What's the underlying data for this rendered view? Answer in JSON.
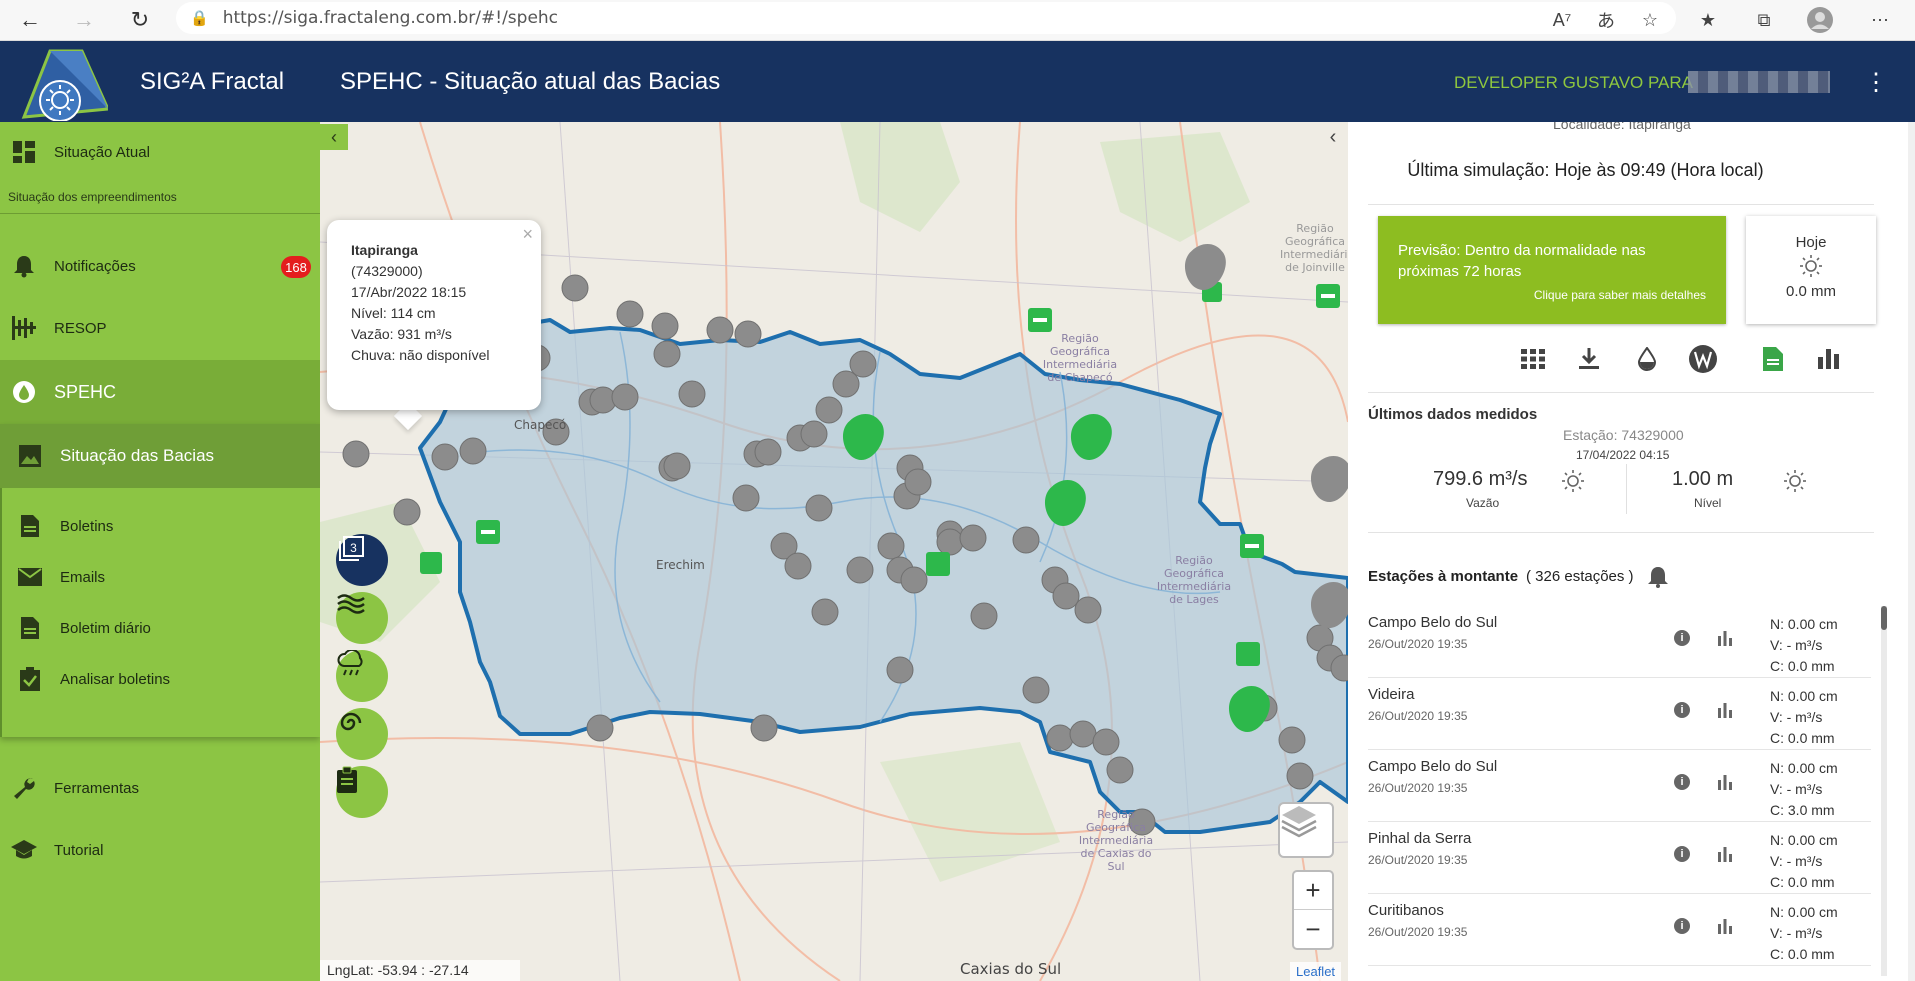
{
  "browser": {
    "url": "https://siga.fractaleng.com.br/#!/spehc"
  },
  "header": {
    "app_name": "SIG²A Fractal",
    "page_title": "SPEHC - Situação atual das Bacias",
    "user_label": "DEVELOPER GUSTAVO PARA"
  },
  "sidebar": {
    "situacao_atual": "Situação Atual",
    "subtitle": "Situação dos empreendimentos",
    "notificacoes": "Notificações",
    "notif_count": "168",
    "resop": "RESOP",
    "spehc": "SPEHC",
    "sub": {
      "situacao_bacias": "Situação das Bacias",
      "boletins": "Boletins",
      "emails": "Emails",
      "boletim_diario": "Boletim diário",
      "analisar_boletins": "Analisar boletins"
    },
    "ferramentas": "Ferramentas",
    "tutorial": "Tutorial"
  },
  "map": {
    "popup": {
      "title": "Itapiranga",
      "code": "(74329000)",
      "datetime": "17/Abr/2022 18:15",
      "nivel": "Nível: 114 cm",
      "vazao": "Vazão: 931 m³/s",
      "chuva": "Chuva: não disponível",
      "close": "×"
    },
    "labels": {
      "chapeco": "Chapecó",
      "erechim": "Erechim",
      "caxias": "Caxias do Sul",
      "regiao_joinville": "Região Geográfica Intermediária de Joinville",
      "regiao_lages": "Região Geográfica Intermediária de Lages",
      "regiao_chapeco": "Região Geográfica Intermediária de Chapecó",
      "regiao_caxias": "Região Geográfica Intermediária de Caxias do Sul"
    },
    "lnglat": "LngLat: -53.94 : -27.14",
    "attribution": "Leaflet",
    "zoom_in": "+",
    "zoom_out": "−",
    "colors": {
      "basin_fill": "#a9c6d9",
      "basin_stroke": "#1e6fae",
      "marker_grey": "#8c8c8c",
      "marker_green": "#2db84b"
    }
  },
  "panel": {
    "localidade": "Localidade: Itapiranga",
    "last_sim": "Última simulação: Hoje às 09:49 (Hora local)",
    "forecast_text": "Previsão: Dentro da normalidade nas próximas 72 horas",
    "forecast_link": "Clique para saber mais detalhes",
    "today_label": "Hoje",
    "today_rain": "0.0 mm",
    "ultimos_title": "Últimos dados medidos",
    "station_label": "Estação: 74329000",
    "station_date": "17/04/2022 04:15",
    "flow_value": "799.6 m³/s",
    "flow_label": "Vazão",
    "level_value": "1.00 m",
    "level_label": "Nível",
    "upstream_title": "Estações à montante",
    "upstream_count": "( 326 estações )",
    "stations": [
      {
        "name": "Campo Belo do Sul",
        "date": "26/Out/2020 19:35",
        "n": "N: 0.00 cm",
        "v": "V: - m³/s",
        "c": "C: 0.0 mm"
      },
      {
        "name": "Videira",
        "date": "26/Out/2020 19:35",
        "n": "N: 0.00 cm",
        "v": "V: - m³/s",
        "c": "C: 0.0 mm"
      },
      {
        "name": "Campo Belo do Sul",
        "date": "26/Out/2020 19:35",
        "n": "N: 0.00 cm",
        "v": "V: - m³/s",
        "c": "C: 3.0 mm"
      },
      {
        "name": "Pinhal da Serra",
        "date": "26/Out/2020 19:35",
        "n": "N: 0.00 cm",
        "v": "V: - m³/s",
        "c": "C: 0.0 mm"
      },
      {
        "name": "Curitibanos",
        "date": "26/Out/2020 19:35",
        "n": "N: 0.00 cm",
        "v": "V: - m³/s",
        "c": "C: 0.0 mm"
      }
    ],
    "colors": {
      "forecast_bg": "#8dbd21",
      "doc_icon": "#3aa648"
    }
  }
}
